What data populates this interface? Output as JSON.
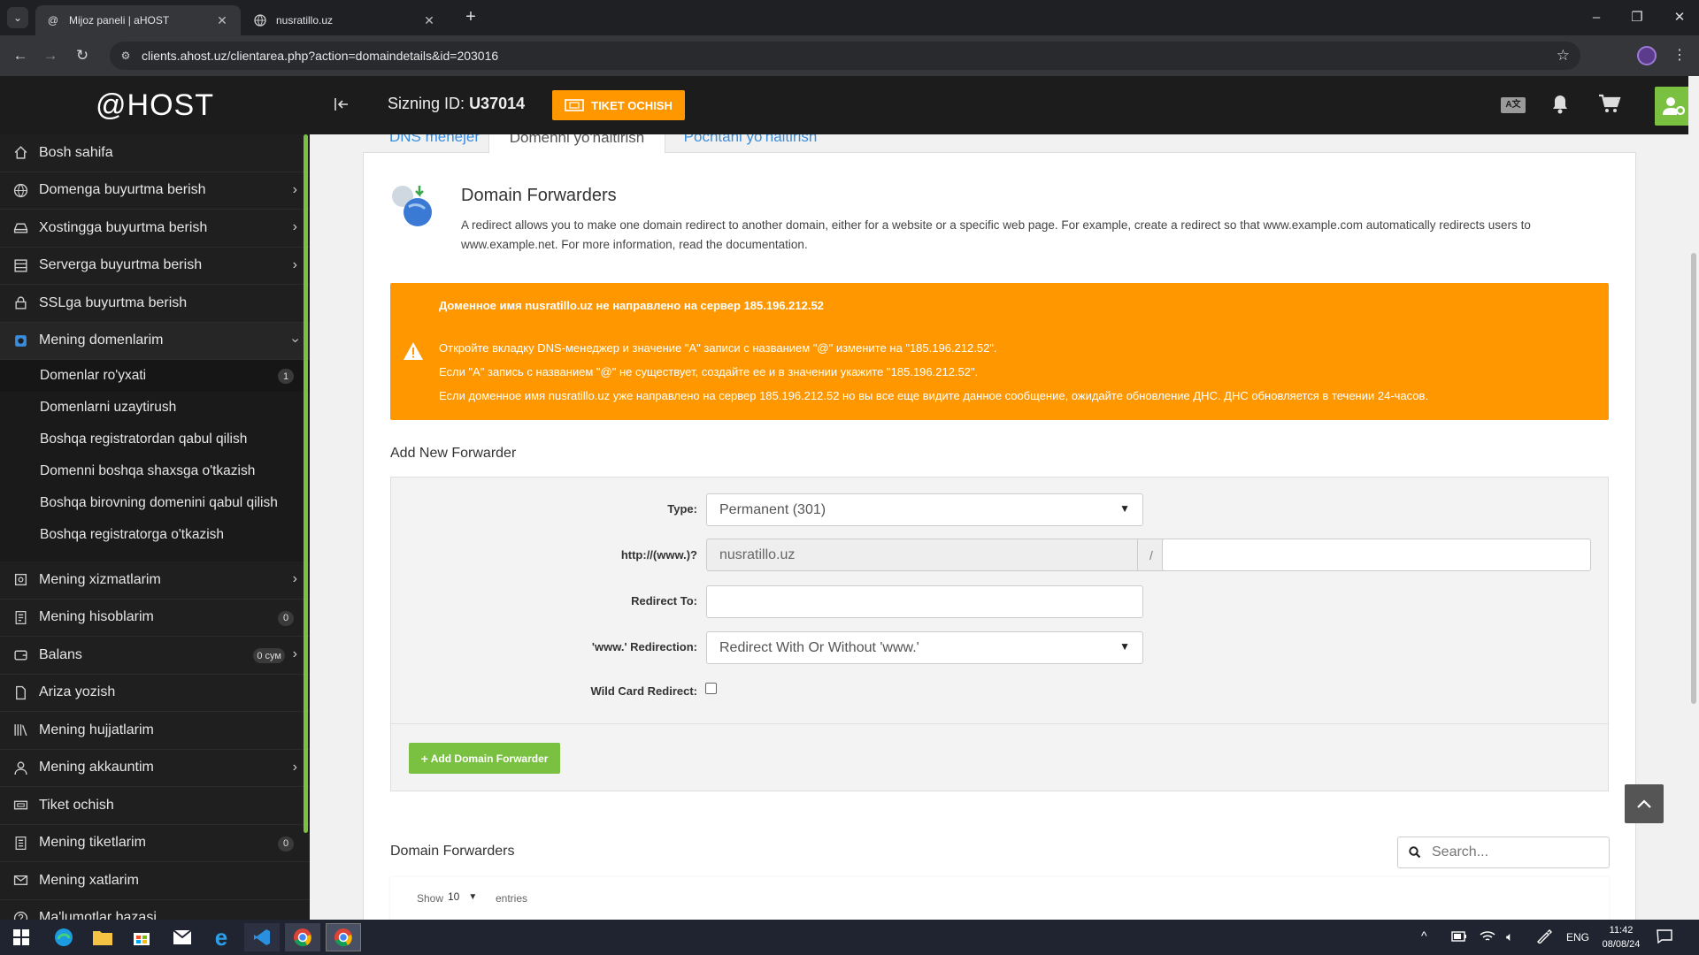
{
  "browser": {
    "tabs": [
      {
        "title": "Mijoz paneli | aHOST",
        "active": true
      },
      {
        "title": "nusratillo.uz",
        "active": false
      }
    ],
    "url": "clients.ahost.uz/clientarea.php?action=domaindetails&id=203016"
  },
  "sidebar": {
    "logo": "@HOST",
    "items": [
      {
        "label": "Bosh sahifa",
        "icon": "home-icon"
      },
      {
        "label": "Domenga buyurtma berish",
        "icon": "globe-icon",
        "chevron": true
      },
      {
        "label": "Xostingga buyurtma berish",
        "icon": "hdd-icon",
        "chevron": true
      },
      {
        "label": "Serverga buyurtma berish",
        "icon": "server-icon",
        "chevron": true
      },
      {
        "label": "SSLga buyurtma berish",
        "icon": "lock-icon"
      },
      {
        "label": "Mening domenlarim",
        "icon": "domain-icon",
        "expanded": true
      }
    ],
    "subitems": [
      {
        "label": "Domenlar ro'yxati",
        "badge": "1"
      },
      {
        "label": "Domenlarni uzaytirush"
      },
      {
        "label": "Boshqa registratordan qabul qilish"
      },
      {
        "label": "Domenni boshqa shaxsga o'tkazish"
      },
      {
        "label": "Boshqa birovning domenini qabul qilish"
      },
      {
        "label": "Boshqa registratorga o'tkazish"
      }
    ],
    "items2": [
      {
        "label": "Mening xizmatlarim",
        "icon": "box-icon",
        "chevron": true
      },
      {
        "label": "Mening hisoblarim",
        "icon": "invoice-icon",
        "badge": "0"
      },
      {
        "label": "Balans",
        "icon": "wallet-icon",
        "badge": "0 сум",
        "chevron": true
      },
      {
        "label": "Ariza yozish",
        "icon": "file-icon"
      },
      {
        "label": "Mening hujjatlarim",
        "icon": "books-icon"
      },
      {
        "label": "Mening akkauntim",
        "icon": "user-icon",
        "chevron": true
      },
      {
        "label": "Tiket ochish",
        "icon": "ticket-icon"
      },
      {
        "label": "Mening tiketlarim",
        "icon": "tickets-icon",
        "badge": "0"
      },
      {
        "label": "Mening xatlarim",
        "icon": "mail-icon"
      },
      {
        "label": "Ma'lumotlar bazasi",
        "icon": "help-icon"
      }
    ]
  },
  "header": {
    "id_label": "Sizning ID:",
    "id_value": "U37014",
    "ticket_button": "TIKET OCHISH"
  },
  "tabs": [
    "DNS menejer",
    "Domenni yo'naltirish",
    "Pochtani yo'naltirish"
  ],
  "forwarders": {
    "title": "Domain Forwarders",
    "description": "A redirect allows you to make one domain redirect to another domain, either for a website or a specific web page. For example, create a redirect so that www.example.com automatically redirects users to www.example.net. For more information, read the documentation.",
    "alert": {
      "heading": "Доменное имя nusratillo.uz не направлено на сервер 185.196.212.52",
      "line1": "Откройте вкладку DNS-менеджер и значение \"A\" записи с названием \"@\" измените на \"185.196.212.52\".",
      "line2": "Если \"A\" запись с названием \"@\" не существует, создайте ее и в значении укажите \"185.196.212.52\".",
      "line3": "Если доменное имя nusratillo.uz уже направлено на сервер 185.196.212.52 но вы все еще видите данное сообщение, ожидайте обновление ДНС. ДНС обновляется в течении 24-часов."
    },
    "add_title": "Add New Forwarder",
    "type_label": "Type:",
    "type_value": "Permanent (301)",
    "http_label": "http://(www.)?",
    "domain_value": "nusratillo.uz",
    "slash": "/",
    "redirect_label": "Redirect To:",
    "www_label": "'www.' Redirection:",
    "www_value": "Redirect With Or Without 'www.'",
    "wildcard_label": "Wild Card Redirect:",
    "add_button": "Add Domain Forwarder",
    "list_title": "Domain Forwarders",
    "search_placeholder": "Search...",
    "show_label": "Show",
    "show_value": "10",
    "entries_label": "entries"
  },
  "taskbar": {
    "lang": "ENG",
    "time": "11:42",
    "date": "08/08/24"
  },
  "colors": {
    "orange": "#ff9800",
    "green": "#7ac142",
    "sidebar": "#1f1f1f"
  }
}
